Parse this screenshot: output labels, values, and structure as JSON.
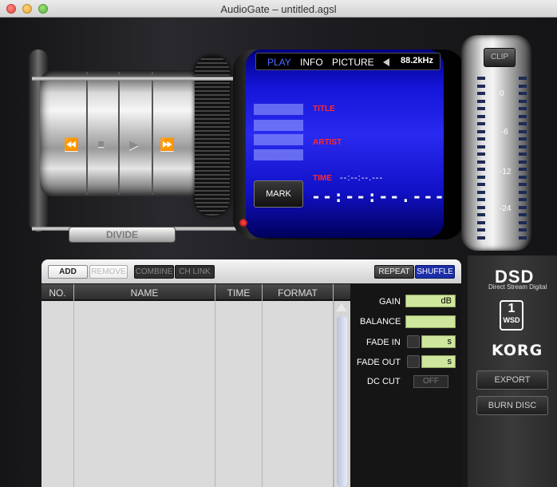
{
  "window": {
    "title": "AudioGate – untitled.agsl"
  },
  "transport": {
    "rewind_icon": "⏪",
    "stop_icon": "■",
    "play_icon": "▶",
    "ffwd_icon": "⏩",
    "divide_label": "DIVIDE"
  },
  "display": {
    "tabs": [
      "PLAY",
      "INFO",
      "PICTURE"
    ],
    "sample_rate": "88.2kHz",
    "title_label": "TITLE",
    "artist_label": "ARTIST",
    "time_label": "TIME",
    "time_small": "--:--:--.---",
    "time_big": "--:--:--.---",
    "mark_label": "MARK"
  },
  "meter": {
    "clip_label": "CLIP",
    "scale": [
      "0",
      "-6",
      "-12",
      "-24"
    ]
  },
  "toolbar": {
    "add": "ADD",
    "remove": "REMOVE",
    "combine": "COMBINE",
    "ch_link": "CH LINK",
    "repeat": "REPEAT",
    "shuffle": "SHUFFLE"
  },
  "table": {
    "columns": [
      "NO.",
      "NAME",
      "TIME",
      "FORMAT"
    ],
    "rows": []
  },
  "properties": {
    "gain_label": "GAIN",
    "gain_unit": "dB",
    "balance_label": "BALANCE",
    "fade_in_label": "FADE IN",
    "fade_in_unit": "s",
    "fade_out_label": "FADE OUT",
    "fade_out_unit": "s",
    "dc_cut_label": "DC CUT",
    "dc_cut_state": "OFF"
  },
  "side": {
    "dsd": "DSD",
    "dsd_sub": "Direct Stream Digital",
    "wsd": "WSD",
    "korg": "KORG",
    "export": "EXPORT",
    "burn": "BURN DISC"
  }
}
